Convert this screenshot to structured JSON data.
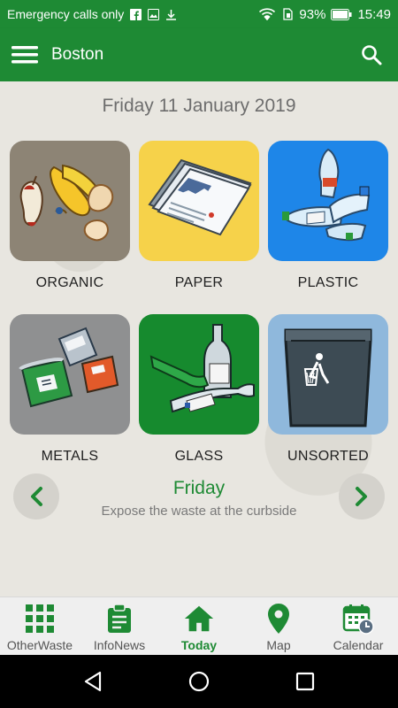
{
  "status_bar": {
    "carrier_text": "Emergency calls only",
    "battery": "93%",
    "time": "15:49"
  },
  "app_bar": {
    "title": "Boston"
  },
  "date": "Friday 11 January 2019",
  "categories": [
    {
      "label": "ORGANIC",
      "color": "#8d8475"
    },
    {
      "label": "PAPER",
      "color": "#f6d24a"
    },
    {
      "label": "PLASTIC",
      "color": "#1e86e8"
    },
    {
      "label": "METALS",
      "color": "#8f9091"
    },
    {
      "label": "GLASS",
      "color": "#168a2e"
    },
    {
      "label": "UNSORTED",
      "color": "#8fb8dc"
    }
  ],
  "collection": {
    "day": "Friday",
    "description": "Expose the waste at the curbside"
  },
  "bottom_nav": [
    {
      "label": "OtherWaste",
      "icon": "grid-icon",
      "active": false
    },
    {
      "label": "InfoNews",
      "icon": "clipboard-icon",
      "active": false
    },
    {
      "label": "Today",
      "icon": "home-icon",
      "active": true
    },
    {
      "label": "Map",
      "icon": "map-pin-icon",
      "active": false
    },
    {
      "label": "Calendar",
      "icon": "calendar-icon",
      "active": false
    }
  ],
  "colors": {
    "primary": "#1e8a34",
    "background": "#e8e6e0"
  }
}
